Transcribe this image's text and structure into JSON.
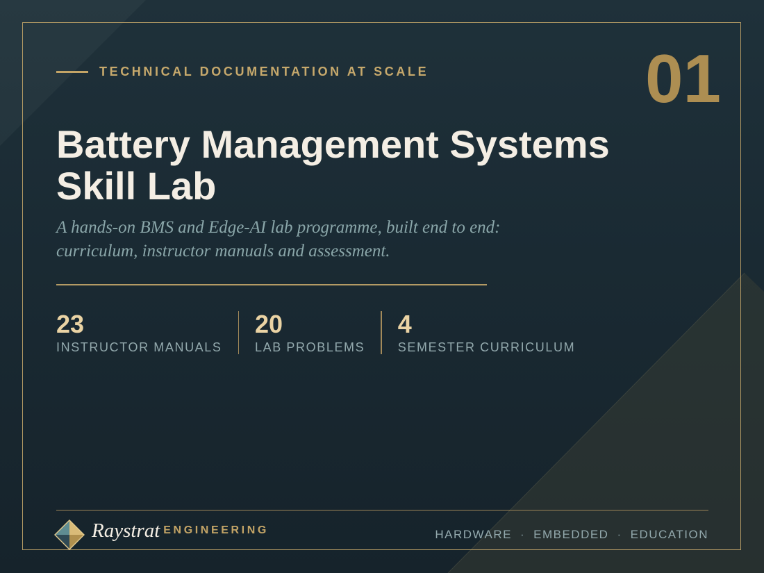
{
  "header": {
    "eyebrow": "TECHNICAL DOCUMENTATION AT SCALE",
    "slide_number": "01"
  },
  "hero": {
    "title_line1": "Battery Management Systems",
    "title_line2": "Skill Lab",
    "subtitle_line1": "A hands-on BMS and Edge-AI lab programme, built end to end:",
    "subtitle_line2": "curriculum, instructor manuals and assessment."
  },
  "stats": [
    {
      "value": "23",
      "label": "INSTRUCTOR MANUALS"
    },
    {
      "value": "20",
      "label": "LAB PROBLEMS"
    },
    {
      "value": "4",
      "label": "SEMESTER CURRICULUM"
    }
  ],
  "footer": {
    "brand_name": "Raystrat",
    "brand_tag": "ENGINEERING",
    "links": [
      "HARDWARE",
      "EMBEDDED",
      "EDUCATION"
    ],
    "separator": "·"
  },
  "colors": {
    "accent_gold": "#c3a466",
    "number_gold": "#ad8e52",
    "title": "#f4eee4",
    "muted_teal": "#8aa6a9",
    "background": "#1a2a33"
  }
}
